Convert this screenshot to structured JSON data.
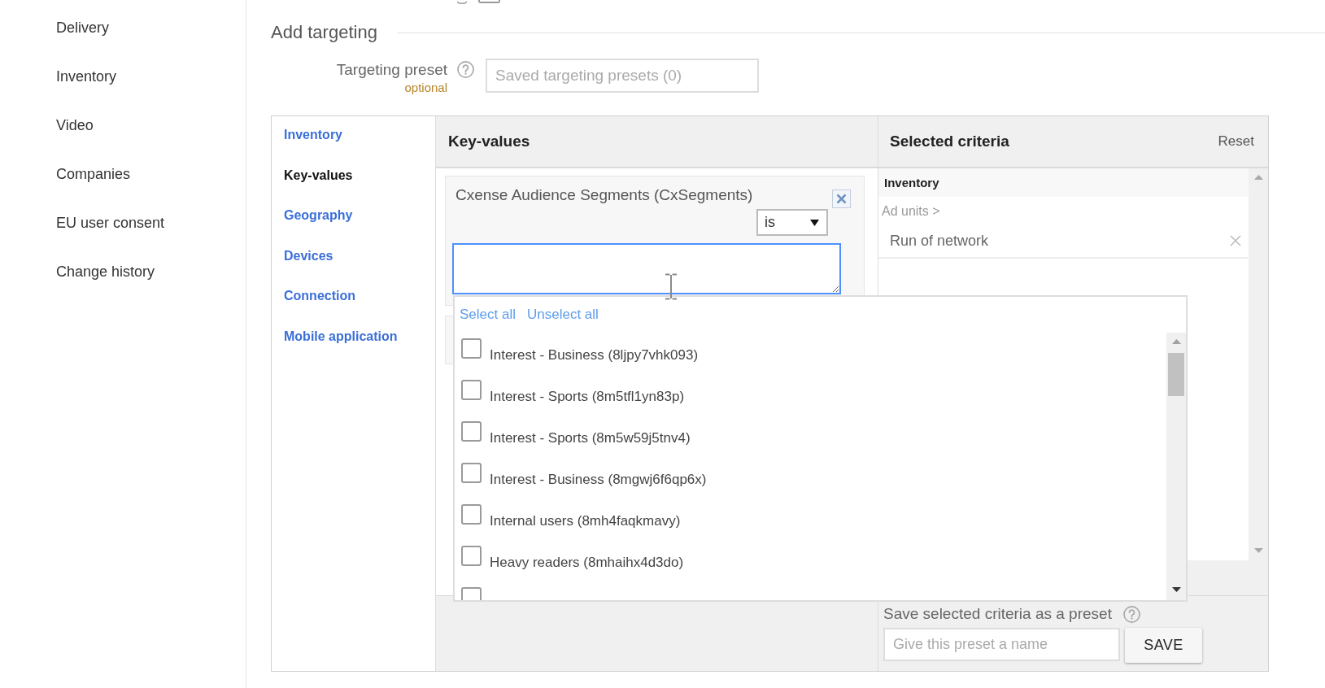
{
  "sidebar": {
    "items": [
      {
        "label": "Delivery"
      },
      {
        "label": "Inventory"
      },
      {
        "label": "Video"
      },
      {
        "label": "Companies"
      },
      {
        "label": "EU user consent"
      },
      {
        "label": "Change history"
      }
    ]
  },
  "top_row": {
    "checked": false
  },
  "section": {
    "title": "Add targeting"
  },
  "targeting_preset": {
    "label": "Targeting preset",
    "hint": "optional",
    "placeholder": "Saved targeting presets (0)"
  },
  "targeting": {
    "categories": [
      {
        "label": "Inventory",
        "selected": false
      },
      {
        "label": "Key-values",
        "selected": true
      },
      {
        "label": "Geography",
        "selected": false
      },
      {
        "label": "Devices",
        "selected": false
      },
      {
        "label": "Connection",
        "selected": false
      },
      {
        "label": "Mobile application",
        "selected": false
      }
    ],
    "key_values": {
      "title": "Key-values",
      "criterion": {
        "name": "Cxense Audience Segments (CxSegments)",
        "operator": "is"
      }
    },
    "dropdown": {
      "actions": [
        "Select all",
        "Unselect all"
      ],
      "options": [
        {
          "label": "Interest - Business (8ljpy7vhk093)",
          "checked": false
        },
        {
          "label": "Interest - Sports (8m5tfl1yn83p)",
          "checked": false
        },
        {
          "label": "Interest - Sports (8m5w59j5tnv4)",
          "checked": false
        },
        {
          "label": "Interest - Business (8mgwj6f6qp6x)",
          "checked": false
        },
        {
          "label": "Internal users (8mh4faqkmavy)",
          "checked": false
        },
        {
          "label": "Heavy readers (8mhaihx4d3do)",
          "checked": false
        },
        {
          "checked": false
        }
      ]
    },
    "selected_criteria": {
      "title": "Selected criteria",
      "reset": "Reset",
      "groups": [
        {
          "title": "Inventory",
          "sections": [
            {
              "title": "Ad units >",
              "items": [
                {
                  "label": "Run of network"
                }
              ]
            }
          ]
        }
      ]
    },
    "save_preset": {
      "label": "Save selected criteria as a preset",
      "placeholder": "Give this preset a name",
      "button": "SAVE"
    }
  }
}
